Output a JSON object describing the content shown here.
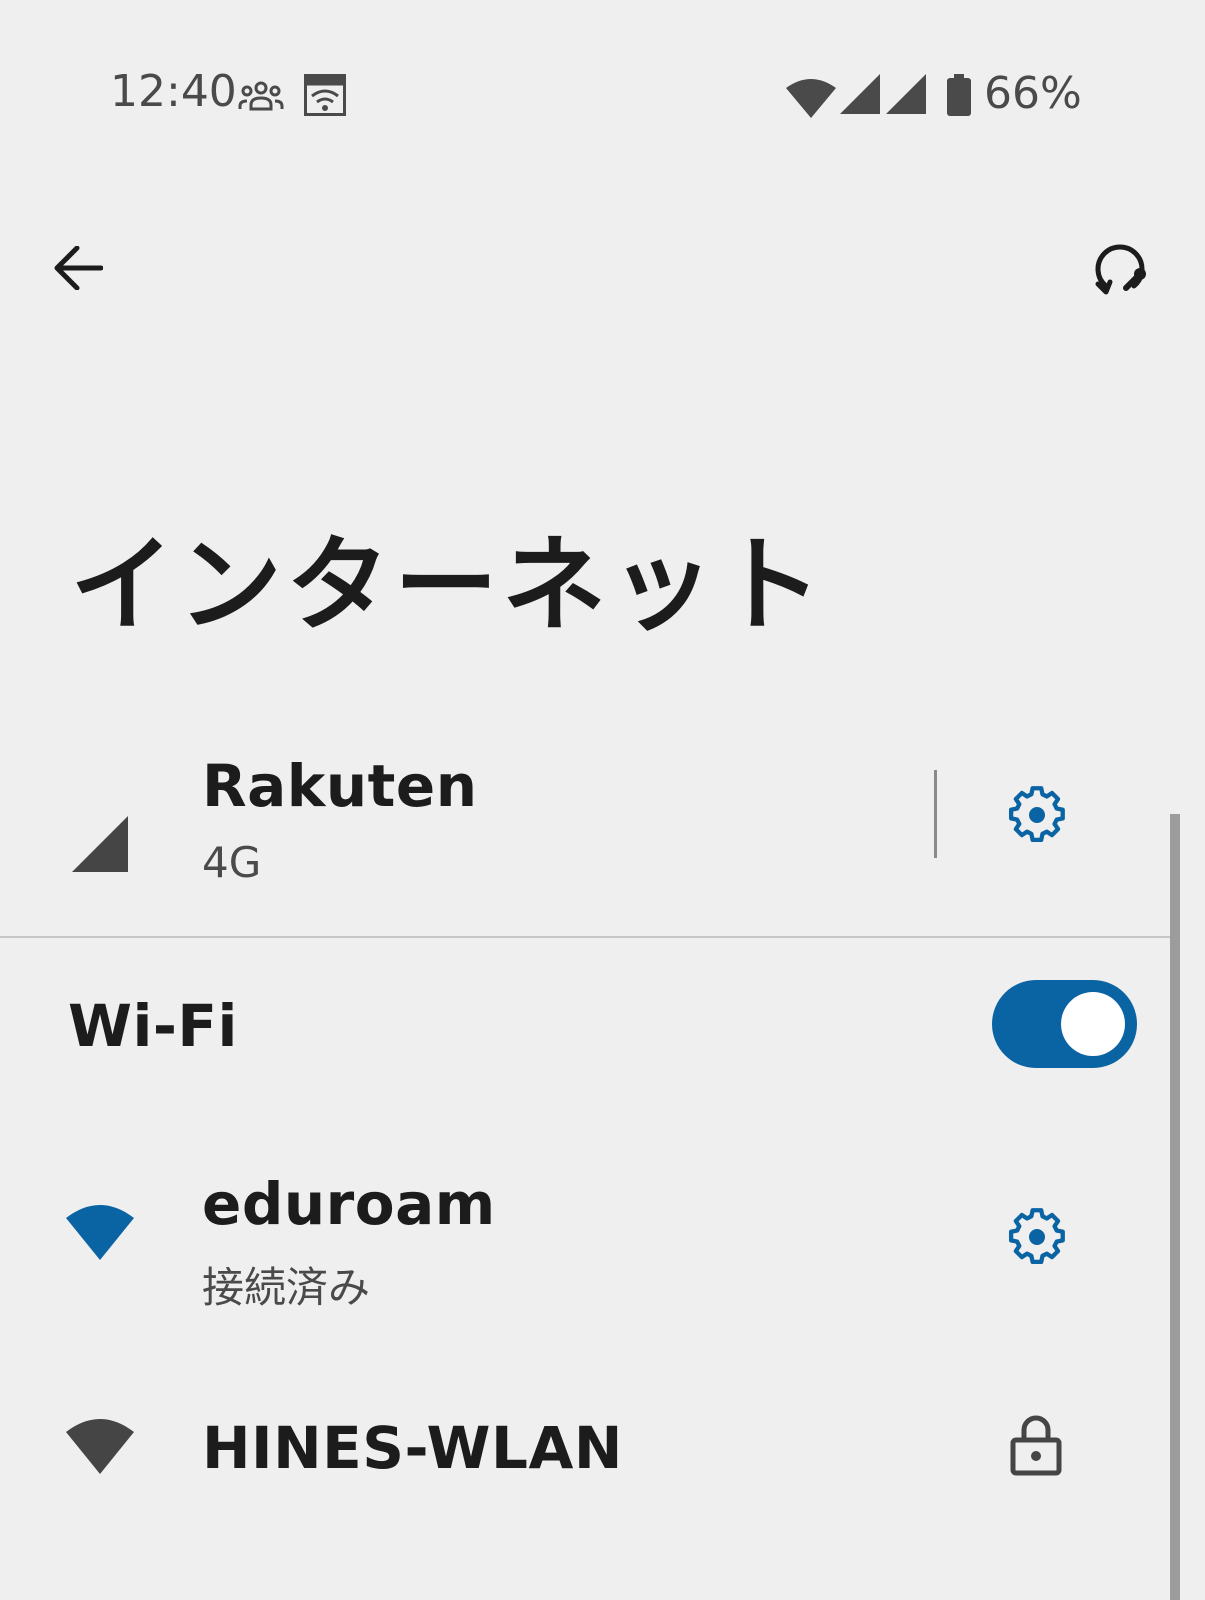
{
  "status_bar": {
    "time": "12:40",
    "battery": "66%",
    "icons": [
      "people-icon",
      "au-wifi-icon",
      "wifi-icon",
      "signal-icon",
      "signal-icon",
      "battery-icon"
    ]
  },
  "app_bar": {
    "back_icon": "arrow-left-icon",
    "reset_icon": "network-reset-icon"
  },
  "page": {
    "title": "インターネット"
  },
  "mobile": {
    "name": "Rakuten",
    "type": "4G",
    "icon": "cell-signal-icon",
    "settings_icon": "gear-icon"
  },
  "wifi": {
    "label": "Wi-Fi",
    "enabled": true,
    "accent_color": "#0a63a3"
  },
  "networks": [
    {
      "name": "eduroam",
      "status": "接続済み",
      "icon": "wifi-icon",
      "action_icon": "gear-icon",
      "color": "#0a63a3"
    },
    {
      "name": "HINES-WLAN",
      "icon": "wifi-icon",
      "action_icon": "lock-icon",
      "color": "#454545"
    }
  ]
}
